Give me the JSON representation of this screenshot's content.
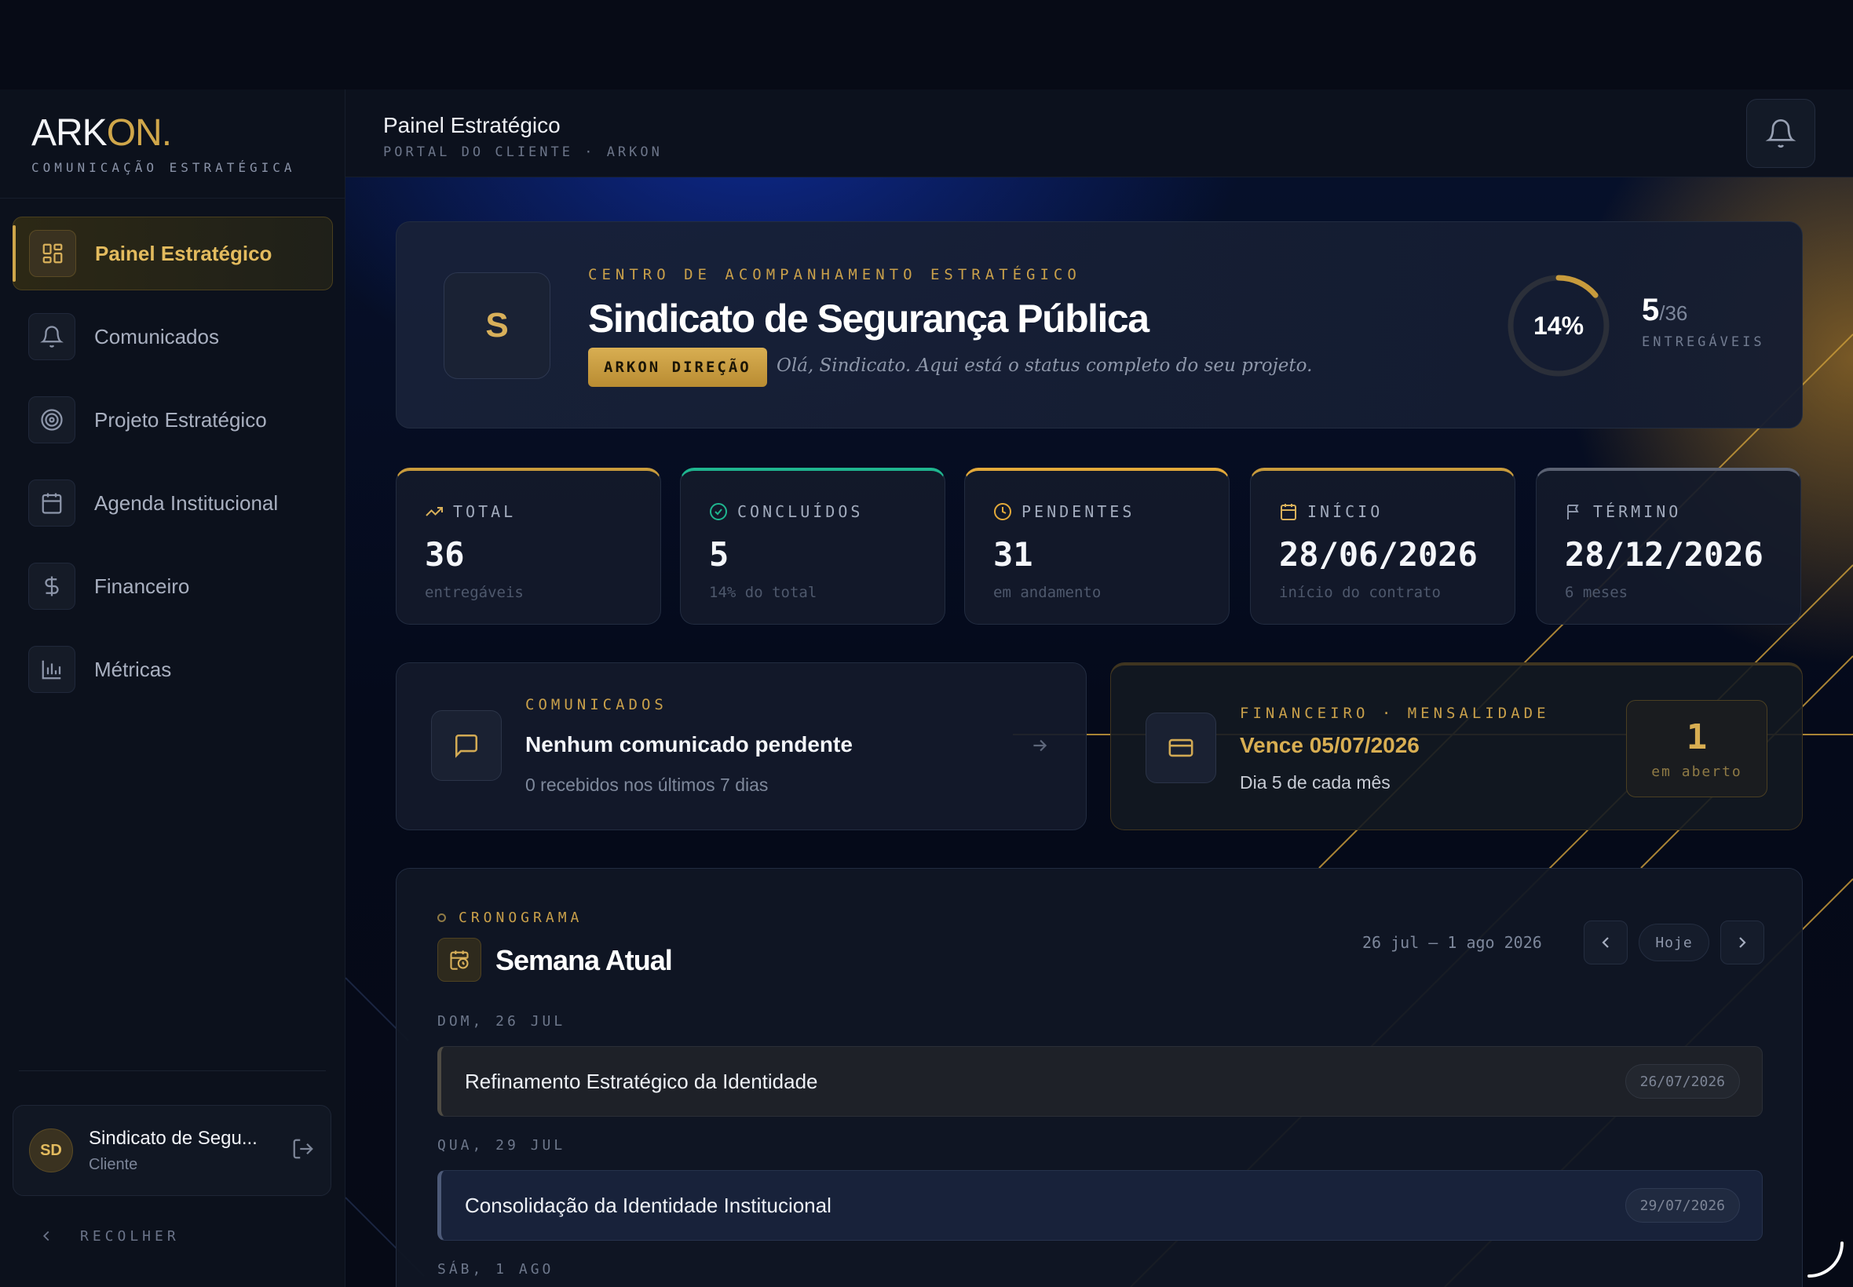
{
  "brand": {
    "logo_main": "ARK",
    "logo_accent": "ON.",
    "tagline": "COMUNICAÇÃO ESTRATÉGICA"
  },
  "sidebar": {
    "items": [
      {
        "label": "Painel Estratégico",
        "icon": "dashboard-grid-icon",
        "active": true
      },
      {
        "label": "Comunicados",
        "icon": "bell-icon"
      },
      {
        "label": "Projeto Estratégico",
        "icon": "target-icon"
      },
      {
        "label": "Agenda Institucional",
        "icon": "calendar-icon"
      },
      {
        "label": "Financeiro",
        "icon": "dollar-icon"
      },
      {
        "label": "Métricas",
        "icon": "bar-chart-icon"
      }
    ],
    "user": {
      "initials": "SD",
      "name": "Sindicato de Segu...",
      "role": "Cliente"
    },
    "collapse_label": "RECOLHER"
  },
  "header": {
    "title": "Painel Estratégico",
    "subtitle": "PORTAL DO CLIENTE · ARKON"
  },
  "hero": {
    "initial": "S",
    "eyebrow": "CENTRO DE ACOMPANHAMENTO ESTRATÉGICO",
    "title": "Sindicato de Segurança Pública",
    "badge": "ARKON DIREÇÃO",
    "greeting": "Olá, Sindicato. Aqui está o status completo do seu projeto.",
    "progress_pct_label": "14%",
    "progress_fraction": 0.14,
    "delivered": "5",
    "delivered_total": "/36",
    "delivered_label": "ENTREGÁVEIS"
  },
  "stats": [
    {
      "label": "TOTAL",
      "value": "36",
      "note": "entregáveis",
      "icon": "trending-up-icon",
      "accent": "#c89b3c"
    },
    {
      "label": "CONCLUÍDOS",
      "value": "5",
      "note": "14% do total",
      "icon": "check-circle-icon",
      "accent": "#1fb58f"
    },
    {
      "label": "PENDENTES",
      "value": "31",
      "note": "em andamento",
      "icon": "clock-icon",
      "accent": "#e2a93a"
    },
    {
      "label": "INÍCIO",
      "value": "28/06/2026",
      "note": "início do contrato",
      "icon": "calendar-icon",
      "accent": "#c89b3c"
    },
    {
      "label": "TÉRMINO",
      "value": "28/12/2026",
      "note": "6 meses",
      "icon": "flag-icon",
      "accent": "#5a6172"
    }
  ],
  "communications": {
    "eyebrow": "COMUNICADOS",
    "title": "Nenhum comunicado pendente",
    "subtitle": "0 recebidos nos últimos 7 dias"
  },
  "finance": {
    "eyebrow": "FINANCEIRO · MENSALIDADE",
    "title": "Vence 05/07/2026",
    "subtitle": "Dia 5 de cada mês",
    "open_count": "1",
    "open_label": "em aberto"
  },
  "schedule": {
    "eyebrow": "CRONOGRAMA",
    "title": "Semana Atual",
    "range": "26 jul – 1 ago 2026",
    "today_label": "Hoje",
    "days": [
      {
        "label": "DOM, 26 JUL",
        "event": "Refinamento Estratégico da Identidade",
        "date": "26/07/2026"
      },
      {
        "label": "QUA, 29 JUL",
        "event": "Consolidação da Identidade Institucional",
        "date": "29/07/2026"
      },
      {
        "label": "SÁB, 1 AGO"
      }
    ]
  },
  "colors": {
    "gold": "#cfa64a",
    "background": "#070b16",
    "success": "#1fb58f",
    "warning": "#e2a93a"
  }
}
